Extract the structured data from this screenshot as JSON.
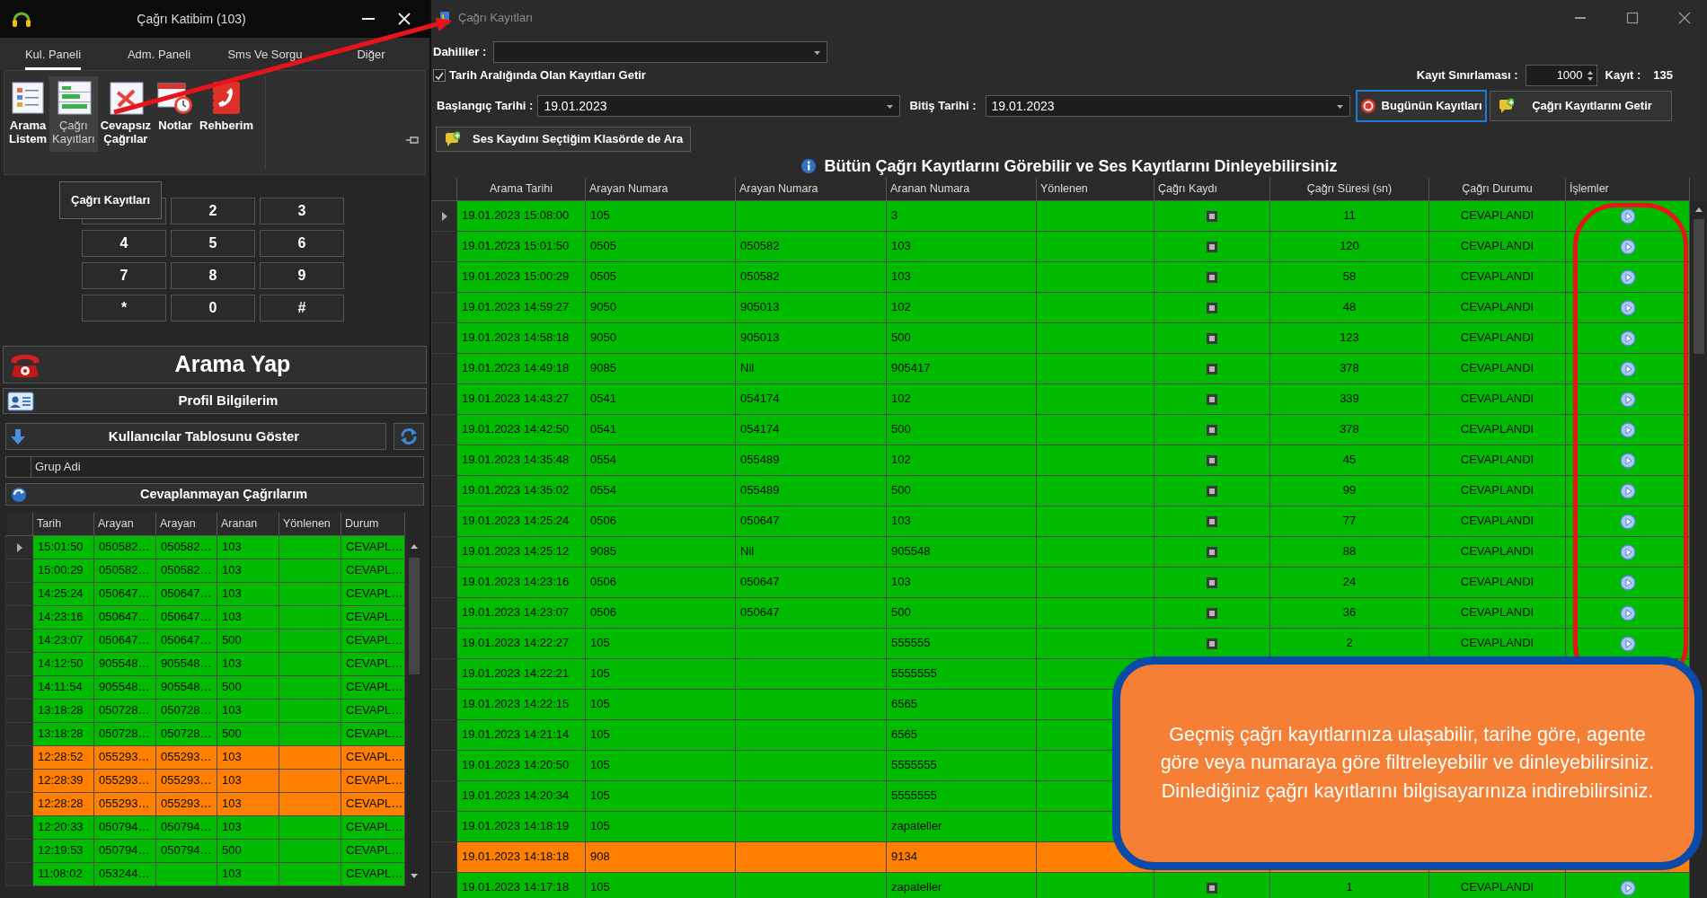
{
  "left_window": {
    "title": "Çağrı Katibim (103)",
    "tabs": [
      {
        "label": "Kul. Paneli",
        "selected": true
      },
      {
        "label": "Adm. Paneli",
        "selected": false
      },
      {
        "label": "Sms Ve Sorgu",
        "selected": false
      },
      {
        "label": "Diğer",
        "selected": false
      }
    ],
    "ribbon": [
      {
        "label": "Arama Listem",
        "kind": "list",
        "hovered": false
      },
      {
        "label": "Çağrı Kayıtları",
        "kind": "records",
        "hovered": true
      },
      {
        "label": "Cevapsız Çağrılar",
        "kind": "missed",
        "hovered": false
      },
      {
        "label": "Notlar",
        "kind": "notes",
        "hovered": false
      },
      {
        "label": "Rehberim",
        "kind": "contacts",
        "hovered": false
      }
    ],
    "tooltip": "Çağrı Kayıtları",
    "keypad": [
      "2",
      "3",
      "4",
      "5",
      "6",
      "7",
      "8",
      "9",
      "*",
      "0",
      "#"
    ],
    "call_button": "Arama Yap",
    "profile_button": "Profil Bilgilerim",
    "users_button": "Kullanıcılar Tablosunu Göster",
    "group_column": "Grup Adi",
    "missed_header": "Cevaplanmayan Çağrılarım",
    "missed_table": {
      "columns": [
        "Tarih",
        "Arayan",
        "Arayan",
        "Aranan",
        "Yönlenen",
        "Durum"
      ],
      "rows": [
        {
          "time": "15:01:50",
          "caller": "050582…",
          "caller_alt": "050582…",
          "callee": "103",
          "status": "CEVAPL…",
          "color": "#00bb00",
          "current": true
        },
        {
          "time": "15:00:29",
          "caller": "050582…",
          "caller_alt": "050582…",
          "callee": "103",
          "status": "CEVAPL…",
          "color": "#00bb00",
          "current": false
        },
        {
          "time": "14:25:24",
          "caller": "050647…",
          "caller_alt": "050647…",
          "callee": "103",
          "status": "CEVAPL…",
          "color": "#00bb00",
          "current": false
        },
        {
          "time": "14:23:16",
          "caller": "050647…",
          "caller_alt": "050647…",
          "callee": "103",
          "status": "CEVAPL…",
          "color": "#00bb00",
          "current": false
        },
        {
          "time": "14:23:07",
          "caller": "050647…",
          "caller_alt": "050647…",
          "callee": "500",
          "status": "CEVAPL…",
          "color": "#00bb00",
          "current": false
        },
        {
          "time": "14:12:50",
          "caller": "905548…",
          "caller_alt": "905548…",
          "callee": "103",
          "status": "CEVAPL…",
          "color": "#00bb00",
          "current": false
        },
        {
          "time": "14:11:54",
          "caller": "905548…",
          "caller_alt": "905548…",
          "callee": "500",
          "status": "CEVAPL…",
          "color": "#00bb00",
          "current": false
        },
        {
          "time": "13:18:28",
          "caller": "050728…",
          "caller_alt": "050728…",
          "callee": "103",
          "status": "CEVAPL…",
          "color": "#00bb00",
          "current": false
        },
        {
          "time": "13:18:28",
          "caller": "050728…",
          "caller_alt": "050728…",
          "callee": "500",
          "status": "CEVAPL…",
          "color": "#00bb00",
          "current": false
        },
        {
          "time": "12:28:52",
          "caller": "055293…",
          "caller_alt": "055293…",
          "callee": "103",
          "status": "CEVAPL…",
          "color": "#ff8000",
          "current": false
        },
        {
          "time": "12:28:39",
          "caller": "055293…",
          "caller_alt": "055293…",
          "callee": "103",
          "status": "CEVAPL…",
          "color": "#ff8000",
          "current": false
        },
        {
          "time": "12:28:28",
          "caller": "055293…",
          "caller_alt": "055293…",
          "callee": "103",
          "status": "CEVAPL…",
          "color": "#ff8000",
          "current": false
        },
        {
          "time": "12:20:33",
          "caller": "050794…",
          "caller_alt": "050794…",
          "callee": "103",
          "status": "CEVAPL…",
          "color": "#00bb00",
          "current": false
        },
        {
          "time": "12:19:53",
          "caller": "050794…",
          "caller_alt": "050794…",
          "callee": "500",
          "status": "CEVAPL…",
          "color": "#00bb00",
          "current": false
        },
        {
          "time": "11:08:02",
          "caller": "053244…",
          "callee": "103",
          "status": "CEVAPL…",
          "color": "#00bb00",
          "current": false
        }
      ]
    }
  },
  "records_window": {
    "title": "Çağrı Kayıtları",
    "extensions_label": "Dahililer :",
    "date_range": {
      "label": "Tarih Aralığında Olan Kayıtları Getir",
      "checked": true
    },
    "limit_label": "Kayıt Sınırlaması :",
    "limit": "1000",
    "count_label": "Kayıt :",
    "count": "135",
    "start_label": "Başlangıç Tarihi :",
    "start": "19.01.2023",
    "end_label": "Bitiş Tarihi :",
    "end": "19.01.2023",
    "today_button": {
      "label": "Bugünün Kayıtları",
      "focused": true
    },
    "fetch_button": "Çağrı Kayıtlarını Getir",
    "search_folder_button": "Ses Kaydını Seçtiğim Klasörde de Ara",
    "heading": "Bütün Çağrı Kayıtlarını Görebilir ve Ses Kayıtlarını Dinleyebilirsiniz",
    "table": {
      "columns": [
        "Arama Tarihi",
        "Arayan Numara",
        "Arayan Numara",
        "Aranan Numara",
        "Yönlenen",
        "Çağrı Kaydı",
        "Çağrı Süresi (sn)",
        "Çağrı Durumu",
        "İşlemler"
      ],
      "rows": [
        {
          "date": "19.01.2023 15:08:00",
          "caller": "105",
          "callee": "3",
          "recorded": true,
          "duration": "11",
          "status": "CEVAPLANDI",
          "color": "#00bb00",
          "current": true
        },
        {
          "date": "19.01.2023 15:01:50",
          "caller": "0505",
          "caller_alt": "050582",
          "callee": "103",
          "recorded": true,
          "duration": "120",
          "status": "CEVAPLANDI",
          "color": "#00bb00",
          "current": false
        },
        {
          "date": "19.01.2023 15:00:29",
          "caller": "0505",
          "caller_alt": "050582",
          "callee": "103",
          "recorded": true,
          "duration": "58",
          "status": "CEVAPLANDI",
          "color": "#00bb00",
          "current": false
        },
        {
          "date": "19.01.2023 14:59:27",
          "caller": "9050",
          "caller_alt": "905013",
          "callee": "102",
          "recorded": true,
          "duration": "48",
          "status": "CEVAPLANDI",
          "color": "#00bb00",
          "current": false
        },
        {
          "date": "19.01.2023 14:58:18",
          "caller": "9050",
          "caller_alt": "905013",
          "callee": "500",
          "recorded": true,
          "duration": "123",
          "status": "CEVAPLANDI",
          "color": "#00bb00",
          "current": false
        },
        {
          "date": "19.01.2023 14:49:18",
          "caller": "9085",
          "caller_alt": "Nil",
          "callee": "905417",
          "recorded": true,
          "duration": "378",
          "status": "CEVAPLANDI",
          "color": "#00bb00",
          "current": false
        },
        {
          "date": "19.01.2023 14:43:27",
          "caller": "0541",
          "caller_alt": "054174",
          "callee": "102",
          "recorded": true,
          "duration": "339",
          "status": "CEVAPLANDI",
          "color": "#00bb00",
          "current": false
        },
        {
          "date": "19.01.2023 14:42:50",
          "caller": "0541",
          "caller_alt": "054174",
          "callee": "500",
          "recorded": true,
          "duration": "378",
          "status": "CEVAPLANDI",
          "color": "#00bb00",
          "current": false
        },
        {
          "date": "19.01.2023 14:35:48",
          "caller": "0554",
          "caller_alt": "055489",
          "callee": "102",
          "recorded": true,
          "duration": "45",
          "status": "CEVAPLANDI",
          "color": "#00bb00",
          "current": false
        },
        {
          "date": "19.01.2023 14:35:02",
          "caller": "0554",
          "caller_alt": "055489",
          "callee": "500",
          "recorded": true,
          "duration": "99",
          "status": "CEVAPLANDI",
          "color": "#00bb00",
          "current": false
        },
        {
          "date": "19.01.2023 14:25:24",
          "caller": "0506",
          "caller_alt": "050647",
          "callee": "103",
          "recorded": true,
          "duration": "77",
          "status": "CEVAPLANDI",
          "color": "#00bb00",
          "current": false
        },
        {
          "date": "19.01.2023 14:25:12",
          "caller": "9085",
          "caller_alt": "Nil",
          "callee": "905548",
          "recorded": true,
          "duration": "88",
          "status": "CEVAPLANDI",
          "color": "#00bb00",
          "current": false
        },
        {
          "date": "19.01.2023 14:23:16",
          "caller": "0506",
          "caller_alt": "050647",
          "callee": "103",
          "recorded": true,
          "duration": "24",
          "status": "CEVAPLANDI",
          "color": "#00bb00",
          "current": false
        },
        {
          "date": "19.01.2023 14:23:07",
          "caller": "0506",
          "caller_alt": "050647",
          "callee": "500",
          "recorded": true,
          "duration": "36",
          "status": "CEVAPLANDI",
          "color": "#00bb00",
          "current": false
        },
        {
          "date": "19.01.2023 14:22:27",
          "caller": "105",
          "callee": "555555",
          "recorded": true,
          "duration": "2",
          "status": "CEVAPLANDI",
          "color": "#00bb00",
          "current": false
        },
        {
          "date": "19.01.2023 14:22:21",
          "caller": "105",
          "callee": "5555555",
          "color": "#00bb00",
          "current": false
        },
        {
          "date": "19.01.2023 14:22:15",
          "caller": "105",
          "callee": "6565",
          "color": "#00bb00",
          "current": false
        },
        {
          "date": "19.01.2023 14:21:14",
          "caller": "105",
          "callee": "6565",
          "color": "#00bb00",
          "current": false
        },
        {
          "date": "19.01.2023 14:20:50",
          "caller": "105",
          "callee": "5555555",
          "color": "#00bb00",
          "current": false
        },
        {
          "date": "19.01.2023 14:20:34",
          "caller": "105",
          "callee": "5555555",
          "color": "#00bb00",
          "current": false
        },
        {
          "date": "19.01.2023 14:18:19",
          "caller": "105",
          "callee": "zapateller",
          "color": "#00bb00",
          "current": false
        },
        {
          "date": "19.01.2023 14:18:18",
          "caller": "908",
          "callee": "9134",
          "color": "#ff8000",
          "current": false
        },
        {
          "date": "19.01.2023 14:17:18",
          "caller": "105",
          "callee": "zapateller",
          "recorded": true,
          "duration": "1",
          "status": "CEVAPLANDI",
          "color": "#00bb00",
          "current": false
        }
      ]
    }
  },
  "callout": {
    "text": "Geçmiş çağrı kayıtlarınıza ulaşabilir, tarihe göre, agente göre veya numaraya göre filtreleyebilir ve dinleyebilirsiniz. Dinlediğiniz çağrı kayıtlarını bilgisayarınıza indirebilirsiniz."
  }
}
